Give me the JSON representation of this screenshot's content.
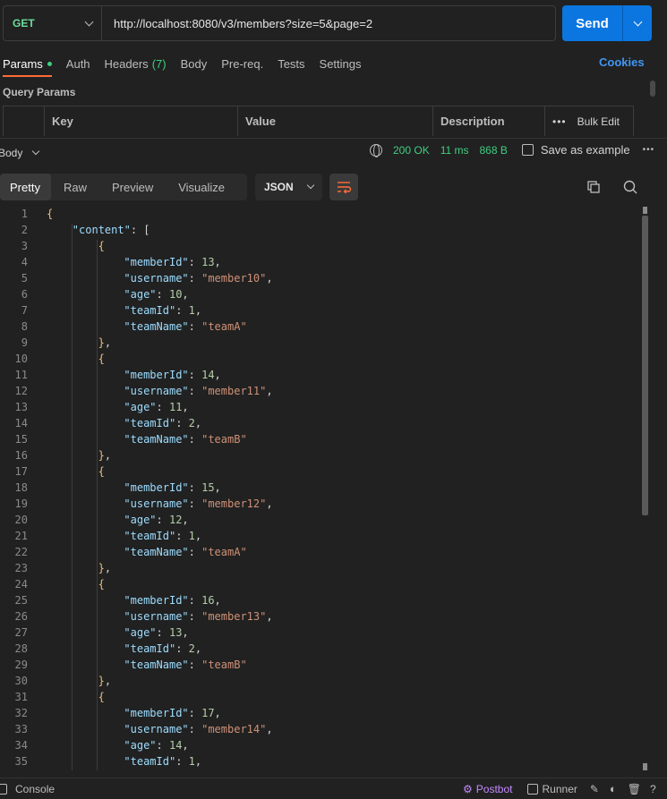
{
  "request": {
    "method": "GET",
    "url": "http://localhost:8080/v3/members?size=5&page=2",
    "send_label": "Send"
  },
  "tabs": [
    {
      "label": "Params"
    },
    {
      "label": "Auth"
    },
    {
      "label": "Headers",
      "count": "(7)"
    },
    {
      "label": "Body"
    },
    {
      "label": "Pre-req."
    },
    {
      "label": "Tests"
    },
    {
      "label": "Settings"
    }
  ],
  "cookies_label": "Cookies",
  "query_params": {
    "title": "Query Params",
    "headers": [
      "Key",
      "Value",
      "Description"
    ],
    "bulk_edit": "Bulk Edit"
  },
  "response": {
    "body_label": "Body",
    "status": "200 OK",
    "time": "11 ms",
    "size": "868 B",
    "save_label": "Save as example",
    "views": [
      "Pretty",
      "Raw",
      "Preview",
      "Visualize"
    ],
    "format": "JSON"
  },
  "code_lines": [
    {
      "n": "1",
      "i": 0,
      "t": [
        [
          "b",
          "{"
        ]
      ]
    },
    {
      "n": "2",
      "i": 1,
      "t": [
        [
          "k",
          "\"content\""
        ],
        [
          "p",
          ": "
        ],
        [
          "p",
          "["
        ]
      ]
    },
    {
      "n": "3",
      "i": 2,
      "t": [
        [
          "b",
          "{"
        ]
      ]
    },
    {
      "n": "4",
      "i": 3,
      "t": [
        [
          "k",
          "\"memberId\""
        ],
        [
          "p",
          ": "
        ],
        [
          "n",
          "13"
        ],
        [
          "p",
          ","
        ]
      ]
    },
    {
      "n": "5",
      "i": 3,
      "t": [
        [
          "k",
          "\"username\""
        ],
        [
          "p",
          ": "
        ],
        [
          "s",
          "\"member10\""
        ],
        [
          "p",
          ","
        ]
      ]
    },
    {
      "n": "6",
      "i": 3,
      "t": [
        [
          "k",
          "\"age\""
        ],
        [
          "p",
          ": "
        ],
        [
          "n",
          "10"
        ],
        [
          "p",
          ","
        ]
      ]
    },
    {
      "n": "7",
      "i": 3,
      "t": [
        [
          "k",
          "\"teamId\""
        ],
        [
          "p",
          ": "
        ],
        [
          "n",
          "1"
        ],
        [
          "p",
          ","
        ]
      ]
    },
    {
      "n": "8",
      "i": 3,
      "t": [
        [
          "k",
          "\"teamName\""
        ],
        [
          "p",
          ": "
        ],
        [
          "s",
          "\"teamA\""
        ]
      ]
    },
    {
      "n": "9",
      "i": 2,
      "t": [
        [
          "b",
          "}"
        ],
        [
          "p",
          ","
        ]
      ]
    },
    {
      "n": "10",
      "i": 2,
      "t": [
        [
          "b",
          "{"
        ]
      ]
    },
    {
      "n": "11",
      "i": 3,
      "t": [
        [
          "k",
          "\"memberId\""
        ],
        [
          "p",
          ": "
        ],
        [
          "n",
          "14"
        ],
        [
          "p",
          ","
        ]
      ]
    },
    {
      "n": "12",
      "i": 3,
      "t": [
        [
          "k",
          "\"username\""
        ],
        [
          "p",
          ": "
        ],
        [
          "s",
          "\"member11\""
        ],
        [
          "p",
          ","
        ]
      ]
    },
    {
      "n": "13",
      "i": 3,
      "t": [
        [
          "k",
          "\"age\""
        ],
        [
          "p",
          ": "
        ],
        [
          "n",
          "11"
        ],
        [
          "p",
          ","
        ]
      ]
    },
    {
      "n": "14",
      "i": 3,
      "t": [
        [
          "k",
          "\"teamId\""
        ],
        [
          "p",
          ": "
        ],
        [
          "n",
          "2"
        ],
        [
          "p",
          ","
        ]
      ]
    },
    {
      "n": "15",
      "i": 3,
      "t": [
        [
          "k",
          "\"teamName\""
        ],
        [
          "p",
          ": "
        ],
        [
          "s",
          "\"teamB\""
        ]
      ]
    },
    {
      "n": "16",
      "i": 2,
      "t": [
        [
          "b",
          "}"
        ],
        [
          "p",
          ","
        ]
      ]
    },
    {
      "n": "17",
      "i": 2,
      "t": [
        [
          "b",
          "{"
        ]
      ]
    },
    {
      "n": "18",
      "i": 3,
      "t": [
        [
          "k",
          "\"memberId\""
        ],
        [
          "p",
          ": "
        ],
        [
          "n",
          "15"
        ],
        [
          "p",
          ","
        ]
      ]
    },
    {
      "n": "19",
      "i": 3,
      "t": [
        [
          "k",
          "\"username\""
        ],
        [
          "p",
          ": "
        ],
        [
          "s",
          "\"member12\""
        ],
        [
          "p",
          ","
        ]
      ]
    },
    {
      "n": "20",
      "i": 3,
      "t": [
        [
          "k",
          "\"age\""
        ],
        [
          "p",
          ": "
        ],
        [
          "n",
          "12"
        ],
        [
          "p",
          ","
        ]
      ]
    },
    {
      "n": "21",
      "i": 3,
      "t": [
        [
          "k",
          "\"teamId\""
        ],
        [
          "p",
          ": "
        ],
        [
          "n",
          "1"
        ],
        [
          "p",
          ","
        ]
      ]
    },
    {
      "n": "22",
      "i": 3,
      "t": [
        [
          "k",
          "\"teamName\""
        ],
        [
          "p",
          ": "
        ],
        [
          "s",
          "\"teamA\""
        ]
      ]
    },
    {
      "n": "23",
      "i": 2,
      "t": [
        [
          "b",
          "}"
        ],
        [
          "p",
          ","
        ]
      ]
    },
    {
      "n": "24",
      "i": 2,
      "t": [
        [
          "b",
          "{"
        ]
      ]
    },
    {
      "n": "25",
      "i": 3,
      "t": [
        [
          "k",
          "\"memberId\""
        ],
        [
          "p",
          ": "
        ],
        [
          "n",
          "16"
        ],
        [
          "p",
          ","
        ]
      ]
    },
    {
      "n": "26",
      "i": 3,
      "t": [
        [
          "k",
          "\"username\""
        ],
        [
          "p",
          ": "
        ],
        [
          "s",
          "\"member13\""
        ],
        [
          "p",
          ","
        ]
      ]
    },
    {
      "n": "27",
      "i": 3,
      "t": [
        [
          "k",
          "\"age\""
        ],
        [
          "p",
          ": "
        ],
        [
          "n",
          "13"
        ],
        [
          "p",
          ","
        ]
      ]
    },
    {
      "n": "28",
      "i": 3,
      "t": [
        [
          "k",
          "\"teamId\""
        ],
        [
          "p",
          ": "
        ],
        [
          "n",
          "2"
        ],
        [
          "p",
          ","
        ]
      ]
    },
    {
      "n": "29",
      "i": 3,
      "t": [
        [
          "k",
          "\"teamName\""
        ],
        [
          "p",
          ": "
        ],
        [
          "s",
          "\"teamB\""
        ]
      ]
    },
    {
      "n": "30",
      "i": 2,
      "t": [
        [
          "b",
          "}"
        ],
        [
          "p",
          ","
        ]
      ]
    },
    {
      "n": "31",
      "i": 2,
      "t": [
        [
          "b",
          "{"
        ]
      ]
    },
    {
      "n": "32",
      "i": 3,
      "t": [
        [
          "k",
          "\"memberId\""
        ],
        [
          "p",
          ": "
        ],
        [
          "n",
          "17"
        ],
        [
          "p",
          ","
        ]
      ]
    },
    {
      "n": "33",
      "i": 3,
      "t": [
        [
          "k",
          "\"username\""
        ],
        [
          "p",
          ": "
        ],
        [
          "s",
          "\"member14\""
        ],
        [
          "p",
          ","
        ]
      ]
    },
    {
      "n": "34",
      "i": 3,
      "t": [
        [
          "k",
          "\"age\""
        ],
        [
          "p",
          ": "
        ],
        [
          "n",
          "14"
        ],
        [
          "p",
          ","
        ]
      ]
    },
    {
      "n": "35",
      "i": 3,
      "t": [
        [
          "k",
          "\"teamId\""
        ],
        [
          "p",
          ": "
        ],
        [
          "n",
          "1"
        ],
        [
          "p",
          ","
        ]
      ]
    }
  ],
  "footer": {
    "console": "Console",
    "postbot": "Postbot",
    "runner": "Runner"
  },
  "colors": {
    "accent": "#0b76e0",
    "active_tab": "#ff6c37",
    "success": "#3fcf7f",
    "method": "#6bdd9a"
  }
}
